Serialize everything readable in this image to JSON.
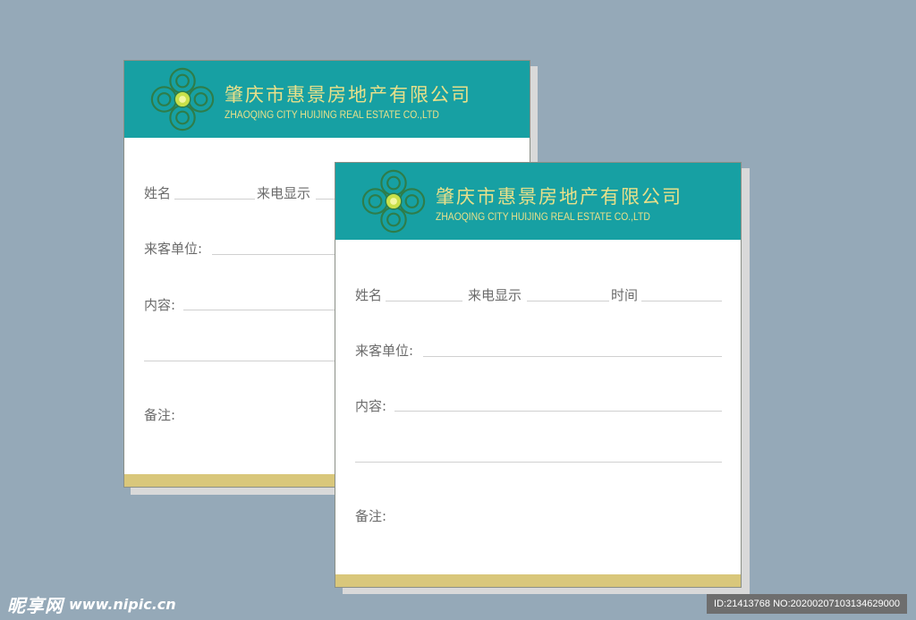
{
  "company": {
    "name_cn": "肇庆市惠景房地产有限公司",
    "name_en": "ZHAOQING CITY HUIJING REAL ESTATE CO.,LTD",
    "logo_icon": "four-petal-flower-logo-icon"
  },
  "form": {
    "name_label": "姓名",
    "caller_id_label": "来电显示",
    "time_label": "时间",
    "visitor_unit_label": "来客单位:",
    "content_label": "内容:",
    "remarks_label": "备注:"
  },
  "colors": {
    "background": "#95a9b8",
    "header_teal": "#17a0a3",
    "footer_gold": "#d9c77b",
    "title_yellow": "#e8e08a",
    "logo_green": "#2e7d4a"
  },
  "watermark": {
    "brand": "昵享网",
    "url": "www.nipic.cn",
    "id_text": "ID:21413768 NO:20200207103134629000"
  }
}
